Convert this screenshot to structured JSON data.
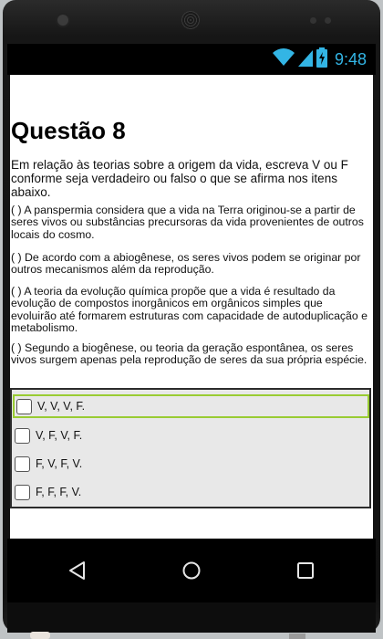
{
  "status_bar": {
    "time": "9:48",
    "icons": [
      "wifi-icon",
      "cellular-signal-icon",
      "battery-charging-icon"
    ],
    "accent_color": "#33b5e5"
  },
  "question": {
    "title": "Questão 8",
    "intro": "Em relação às teorias sobre a origem da vida, escreva V ou F conforme seja verdadeiro ou falso o que se afirma nos itens abaixo.",
    "items": [
      "( ) A panspermia considera que a vida na Terra originou-se a partir de seres vivos ou substâncias precursoras da vida provenientes de outros locais do cosmo.",
      "( ) De acordo com a abiogênese, os seres vivos podem se originar por outros mecanismos além da reprodução.",
      "( ) A teoria da evolução química propõe que a vida é resultado da evolução de compostos inorgânicos em orgânicos simples que evoluirão até formarem estruturas com capacidade de autoduplicação e metabolismo.",
      "( ) Segundo a biogênese, ou teoria da geração espontânea, os seres vivos surgem apenas pela reprodução de seres da sua própria espécie."
    ]
  },
  "options": [
    {
      "label": "V, V, V, F.",
      "selected": true,
      "checked": false
    },
    {
      "label": "V, F, V, F.",
      "selected": false,
      "checked": false
    },
    {
      "label": "F, V, F, V.",
      "selected": false,
      "checked": false
    },
    {
      "label": "F, F, F, V.",
      "selected": false,
      "checked": false
    }
  ],
  "nav_bar": {
    "buttons": [
      "back-icon",
      "home-icon",
      "recents-icon"
    ]
  },
  "colors": {
    "selection_border": "#99cc33",
    "options_background": "#e8e8e8"
  }
}
